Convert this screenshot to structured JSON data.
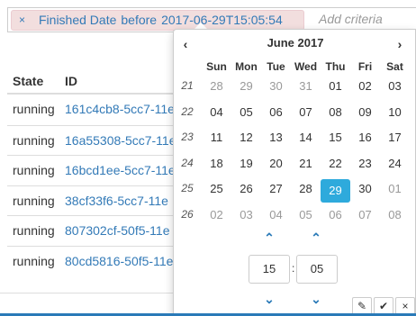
{
  "criteria": {
    "tag_remove": "×",
    "tag_field": "Finished Date",
    "tag_operator": "before",
    "tag_value": "2017-06-29T15:05:54",
    "add_placeholder": "Add criteria"
  },
  "table": {
    "headers": {
      "state": "State",
      "id": "ID"
    },
    "rows": [
      {
        "state": "running",
        "id": "161c4cb8-5cc7-11e"
      },
      {
        "state": "running",
        "id": "16a55308-5cc7-11e"
      },
      {
        "state": "running",
        "id": "16bcd1ee-5cc7-11e"
      },
      {
        "state": "running",
        "id": "38cf33f6-5cc7-11e"
      },
      {
        "state": "running",
        "id": "807302cf-50f5-11e"
      },
      {
        "state": "running",
        "id": "80cd5816-50f5-11e"
      }
    ]
  },
  "datepicker": {
    "prev_icon": "‹",
    "next_icon": "›",
    "month_title": "June 2017",
    "weekdays": [
      "Sun",
      "Mon",
      "Tue",
      "Wed",
      "Thu",
      "Fri",
      "Sat"
    ],
    "weeks": [
      {
        "num": "21",
        "days": [
          {
            "d": "28",
            "m": true
          },
          {
            "d": "29",
            "m": true
          },
          {
            "d": "30",
            "m": true
          },
          {
            "d": "31",
            "m": true
          },
          {
            "d": "01"
          },
          {
            "d": "02"
          },
          {
            "d": "03"
          }
        ]
      },
      {
        "num": "22",
        "days": [
          {
            "d": "04"
          },
          {
            "d": "05"
          },
          {
            "d": "06"
          },
          {
            "d": "07"
          },
          {
            "d": "08"
          },
          {
            "d": "09"
          },
          {
            "d": "10"
          }
        ]
      },
      {
        "num": "23",
        "days": [
          {
            "d": "11"
          },
          {
            "d": "12"
          },
          {
            "d": "13"
          },
          {
            "d": "14"
          },
          {
            "d": "15"
          },
          {
            "d": "16"
          },
          {
            "d": "17"
          }
        ]
      },
      {
        "num": "24",
        "days": [
          {
            "d": "18"
          },
          {
            "d": "19"
          },
          {
            "d": "20"
          },
          {
            "d": "21"
          },
          {
            "d": "22"
          },
          {
            "d": "23"
          },
          {
            "d": "24"
          }
        ]
      },
      {
        "num": "25",
        "days": [
          {
            "d": "25"
          },
          {
            "d": "26"
          },
          {
            "d": "27"
          },
          {
            "d": "28"
          },
          {
            "d": "29",
            "sel": true
          },
          {
            "d": "30"
          },
          {
            "d": "01",
            "m": true
          }
        ]
      },
      {
        "num": "26",
        "days": [
          {
            "d": "02",
            "m": true
          },
          {
            "d": "03",
            "m": true
          },
          {
            "d": "04",
            "m": true
          },
          {
            "d": "05",
            "m": true
          },
          {
            "d": "06",
            "m": true
          },
          {
            "d": "07",
            "m": true
          },
          {
            "d": "08",
            "m": true
          }
        ]
      }
    ],
    "hour": "15",
    "minute": "05",
    "separator": ":",
    "icons": {
      "edit": "pencil-icon",
      "confirm": "check-icon",
      "close": "close-icon"
    },
    "colors": {
      "selected": "#2eaadc",
      "accent": "#2a7ab8"
    }
  }
}
